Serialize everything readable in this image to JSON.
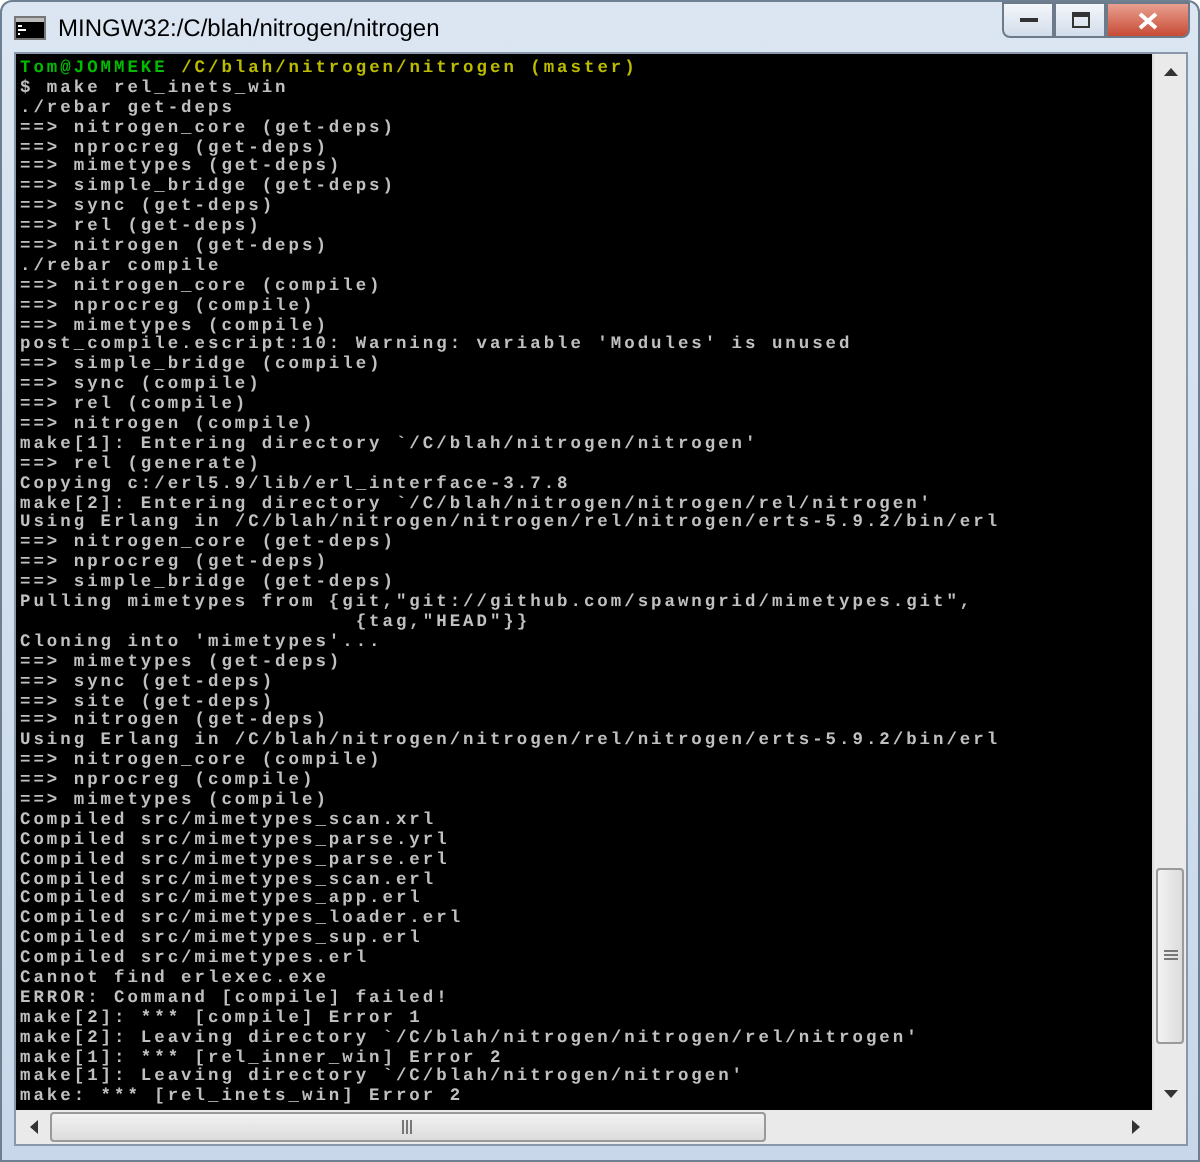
{
  "window": {
    "title": "MINGW32:/C/blah/nitrogen/nitrogen"
  },
  "terminal": {
    "lines": [
      {
        "kind": "prompt",
        "user": "Tom@JOMMEKE",
        "path": "/C/blah/nitrogen/nitrogen (master)"
      },
      {
        "kind": "output",
        "text": "$ make rel_inets_win"
      },
      {
        "kind": "output",
        "text": "./rebar get-deps"
      },
      {
        "kind": "output",
        "text": "==> nitrogen_core (get-deps)"
      },
      {
        "kind": "output",
        "text": "==> nprocreg (get-deps)"
      },
      {
        "kind": "output",
        "text": "==> mimetypes (get-deps)"
      },
      {
        "kind": "output",
        "text": "==> simple_bridge (get-deps)"
      },
      {
        "kind": "output",
        "text": "==> sync (get-deps)"
      },
      {
        "kind": "output",
        "text": "==> rel (get-deps)"
      },
      {
        "kind": "output",
        "text": "==> nitrogen (get-deps)"
      },
      {
        "kind": "output",
        "text": "./rebar compile"
      },
      {
        "kind": "output",
        "text": "==> nitrogen_core (compile)"
      },
      {
        "kind": "output",
        "text": "==> nprocreg (compile)"
      },
      {
        "kind": "output",
        "text": "==> mimetypes (compile)"
      },
      {
        "kind": "output",
        "text": "post_compile.escript:10: Warning: variable 'Modules' is unused"
      },
      {
        "kind": "output",
        "text": "==> simple_bridge (compile)"
      },
      {
        "kind": "output",
        "text": "==> sync (compile)"
      },
      {
        "kind": "output",
        "text": "==> rel (compile)"
      },
      {
        "kind": "output",
        "text": "==> nitrogen (compile)"
      },
      {
        "kind": "output",
        "text": "make[1]: Entering directory `/C/blah/nitrogen/nitrogen'"
      },
      {
        "kind": "output",
        "text": "==> rel (generate)"
      },
      {
        "kind": "output",
        "text": "Copying c:/erl5.9/lib/erl_interface-3.7.8"
      },
      {
        "kind": "output",
        "text": "make[2]: Entering directory `/C/blah/nitrogen/nitrogen/rel/nitrogen'"
      },
      {
        "kind": "output",
        "text": "Using Erlang in /C/blah/nitrogen/nitrogen/rel/nitrogen/erts-5.9.2/bin/erl"
      },
      {
        "kind": "output",
        "text": "==> nitrogen_core (get-deps)"
      },
      {
        "kind": "output",
        "text": "==> nprocreg (get-deps)"
      },
      {
        "kind": "output",
        "text": "==> simple_bridge (get-deps)"
      },
      {
        "kind": "output",
        "text": "Pulling mimetypes from {git,\"git://github.com/spawngrid/mimetypes.git\","
      },
      {
        "kind": "output",
        "text": "                         {tag,\"HEAD\"}}"
      },
      {
        "kind": "output",
        "text": "Cloning into 'mimetypes'..."
      },
      {
        "kind": "output",
        "text": "==> mimetypes (get-deps)"
      },
      {
        "kind": "output",
        "text": "==> sync (get-deps)"
      },
      {
        "kind": "output",
        "text": "==> site (get-deps)"
      },
      {
        "kind": "output",
        "text": "==> nitrogen (get-deps)"
      },
      {
        "kind": "output",
        "text": "Using Erlang in /C/blah/nitrogen/nitrogen/rel/nitrogen/erts-5.9.2/bin/erl"
      },
      {
        "kind": "output",
        "text": "==> nitrogen_core (compile)"
      },
      {
        "kind": "output",
        "text": "==> nprocreg (compile)"
      },
      {
        "kind": "output",
        "text": "==> mimetypes (compile)"
      },
      {
        "kind": "output",
        "text": "Compiled src/mimetypes_scan.xrl"
      },
      {
        "kind": "output",
        "text": "Compiled src/mimetypes_parse.yrl"
      },
      {
        "kind": "output",
        "text": "Compiled src/mimetypes_parse.erl"
      },
      {
        "kind": "output",
        "text": "Compiled src/mimetypes_scan.erl"
      },
      {
        "kind": "output",
        "text": "Compiled src/mimetypes_app.erl"
      },
      {
        "kind": "output",
        "text": "Compiled src/mimetypes_loader.erl"
      },
      {
        "kind": "output",
        "text": "Compiled src/mimetypes_sup.erl"
      },
      {
        "kind": "output",
        "text": "Compiled src/mimetypes.erl"
      },
      {
        "kind": "output",
        "text": "Cannot find erlexec.exe"
      },
      {
        "kind": "output",
        "text": "ERROR: Command [compile] failed!"
      },
      {
        "kind": "output",
        "text": "make[2]: *** [compile] Error 1"
      },
      {
        "kind": "output",
        "text": "make[2]: Leaving directory `/C/blah/nitrogen/nitrogen/rel/nitrogen'"
      },
      {
        "kind": "output",
        "text": "make[1]: *** [rel_inner_win] Error 2"
      },
      {
        "kind": "output",
        "text": "make[1]: Leaving directory `/C/blah/nitrogen/nitrogen'"
      },
      {
        "kind": "output",
        "text": "make: *** [rel_inets_win] Error 2"
      }
    ]
  }
}
